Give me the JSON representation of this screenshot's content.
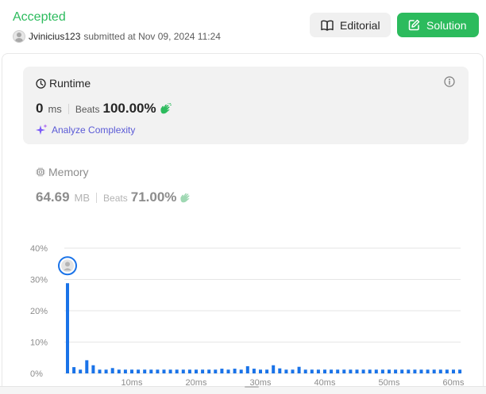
{
  "header": {
    "status": "Accepted",
    "username": "Jvinicius123",
    "submitted_text": "submitted at Nov 09, 2024 11:24",
    "editorial_label": "Editorial",
    "solution_label": "Solution"
  },
  "runtime": {
    "title": "Runtime",
    "value": "0",
    "unit": "ms",
    "beats_label": "Beats",
    "beats_value": "100.00%",
    "analyze_label": "Analyze Complexity"
  },
  "memory": {
    "title": "Memory",
    "value": "64.69",
    "unit": "MB",
    "beats_label": "Beats",
    "beats_value": "71.00%"
  },
  "colors": {
    "accepted": "#2cbb5d",
    "bar": "#1a73e8",
    "analyze": "#5a5ad6"
  },
  "chart_data": {
    "type": "bar",
    "ylim": [
      0,
      40
    ],
    "y_ticks": [
      "0%",
      "10%",
      "20%",
      "30%",
      "40%"
    ],
    "y_tick_values": [
      0,
      10,
      20,
      30,
      40
    ],
    "x_tick_labels": [
      "10ms",
      "20ms",
      "30ms",
      "40ms",
      "50ms",
      "60ms"
    ],
    "x_tick_values": [
      10,
      20,
      30,
      40,
      50,
      60
    ],
    "xlim": [
      0,
      62
    ],
    "x": [
      0,
      1,
      2,
      3,
      4,
      5,
      6,
      7,
      8,
      9,
      10,
      11,
      12,
      13,
      14,
      15,
      16,
      17,
      18,
      19,
      20,
      21,
      22,
      23,
      24,
      25,
      26,
      27,
      28,
      29,
      30,
      31,
      32,
      33,
      34,
      35,
      36,
      37,
      38,
      39,
      40,
      41,
      42,
      43,
      44,
      45,
      46,
      47,
      48,
      49,
      50,
      51,
      52,
      53,
      54,
      55,
      56,
      57,
      58,
      59,
      60,
      61
    ],
    "values": [
      28.8,
      2.0,
      1.2,
      4.2,
      2.6,
      1.2,
      1.2,
      1.7,
      1.2,
      1.2,
      1.2,
      1.2,
      1.2,
      1.2,
      1.2,
      1.2,
      1.2,
      1.2,
      1.2,
      1.2,
      1.2,
      1.2,
      1.2,
      1.2,
      1.5,
      1.2,
      1.5,
      1.2,
      2.3,
      1.5,
      1.2,
      1.2,
      2.6,
      1.6,
      1.2,
      1.2,
      2.1,
      1.2,
      1.2,
      1.2,
      1.2,
      1.2,
      1.2,
      1.2,
      1.2,
      1.2,
      1.2,
      1.2,
      1.2,
      1.2,
      1.2,
      1.2,
      1.2,
      1.2,
      1.2,
      1.2,
      1.2,
      1.2,
      1.2,
      1.2,
      1.2,
      1.2
    ],
    "marker_x": 0
  }
}
